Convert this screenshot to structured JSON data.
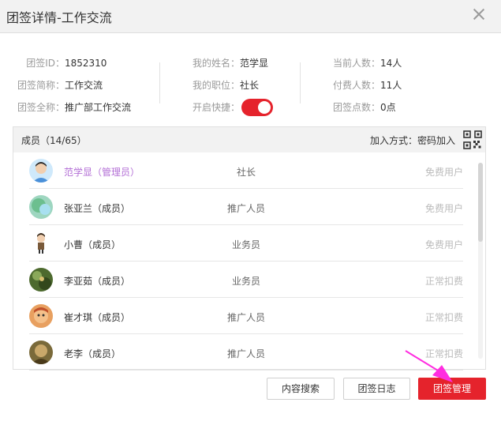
{
  "window": {
    "title": "团签详情-工作交流"
  },
  "info": {
    "col1": [
      {
        "label": "团签ID：",
        "value": "1852310"
      },
      {
        "label": "团签简称：",
        "value": "工作交流"
      },
      {
        "label": "团签全称：",
        "value": "推广部工作交流"
      }
    ],
    "col2": [
      {
        "label": "我的姓名：",
        "value": "范学显"
      },
      {
        "label": "我的职位：",
        "value": "社长"
      },
      {
        "label": "开启快捷：",
        "value": ""
      }
    ],
    "col3": [
      {
        "label": "当前人数：",
        "value": "14人"
      },
      {
        "label": "付费人数：",
        "value": "11人"
      },
      {
        "label": "团签点数：",
        "value": "0点"
      }
    ],
    "shortcut_enabled": true
  },
  "members": {
    "title": "成员（14/65）",
    "join_mode": "加入方式：密码加入",
    "qr_icon": "qr-code-icon",
    "list": [
      {
        "name": "范学显（管理员）",
        "role": "社长",
        "type": "免费用户",
        "admin": true,
        "avatar_color": "#6ab4e8"
      },
      {
        "name": "张亚兰（成员）",
        "role": "推广人员",
        "type": "免费用户",
        "admin": false,
        "avatar_color": "#7fc7a8"
      },
      {
        "name": "小曹（成员）",
        "role": "业务员",
        "type": "免费用户",
        "admin": false,
        "avatar_color": "#ffffff"
      },
      {
        "name": "李亚茹（成员）",
        "role": "业务员",
        "type": "正常扣费",
        "admin": false,
        "avatar_color": "#5d7a3a"
      },
      {
        "name": "崔才琪（成员）",
        "role": "推广人员",
        "type": "正常扣费",
        "admin": false,
        "avatar_color": "#d98a4a"
      },
      {
        "name": "老李（成员）",
        "role": "推广人员",
        "type": "正常扣费",
        "admin": false,
        "avatar_color": "#8a7a4a"
      }
    ]
  },
  "buttons": {
    "search": "内容搜索",
    "log": "团签日志",
    "manage": "团签管理"
  },
  "colors": {
    "accent": "#e5232c",
    "admin_name": "#b36fd6",
    "annotation_arrow": "#ff2de0"
  }
}
